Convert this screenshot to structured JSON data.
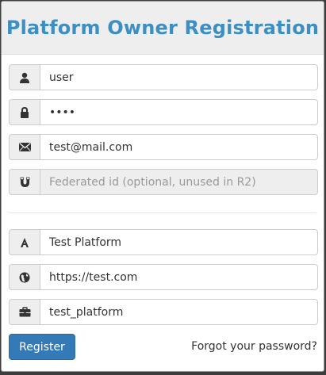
{
  "modal": {
    "title": "Platform Owner Registration"
  },
  "form": {
    "username": {
      "value": "user",
      "icon": "user-icon"
    },
    "password": {
      "value": "pass",
      "icon": "lock-icon"
    },
    "email": {
      "value": "test@mail.com",
      "icon": "envelope-icon"
    },
    "federated_id": {
      "value": "",
      "placeholder": "Federated id (optional, unused in R2)",
      "icon": "magnet-icon"
    },
    "platform_name": {
      "value": "Test Platform",
      "icon": "font-icon"
    },
    "platform_url": {
      "value": "https://test.com",
      "icon": "globe-icon"
    },
    "platform_id": {
      "value": "test_platform",
      "icon": "briefcase-icon"
    }
  },
  "actions": {
    "register_label": "Register",
    "forgot_label": "Forgot your password?"
  },
  "colors": {
    "title": "#3d8ec3",
    "primary_button": "#337ab7"
  }
}
